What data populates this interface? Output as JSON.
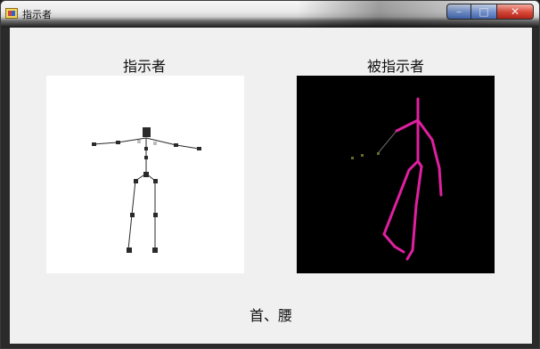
{
  "window": {
    "title": "指示者",
    "controls": {
      "minimize_icon": "minimize-icon",
      "maximize_icon": "maximize-icon",
      "close_icon": "close-icon"
    }
  },
  "panels": {
    "left": {
      "label": "指示者",
      "background": "#ffffff"
    },
    "right": {
      "label": "被指示者",
      "background": "#000000"
    }
  },
  "status": {
    "text": "首、腰"
  },
  "colors": {
    "skeleton_gray": "#2a2a2a",
    "skeleton_magenta": "#e020a0",
    "joint_olive": "#6a6a2a"
  }
}
